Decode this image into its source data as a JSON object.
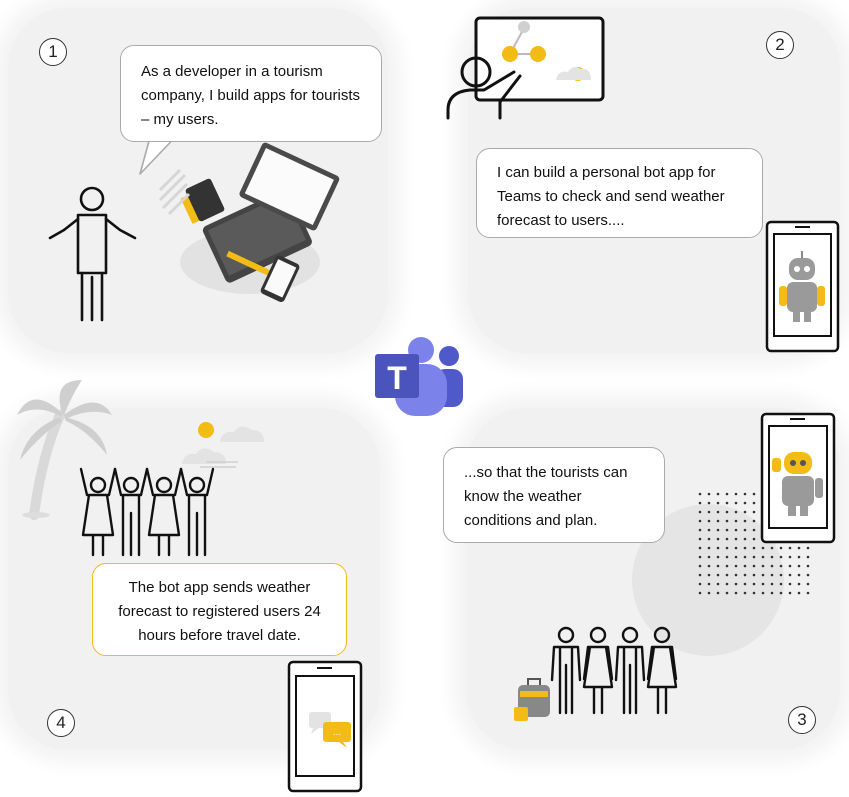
{
  "steps": [
    {
      "number": "1",
      "text": "As a developer in a tourism company, I build apps for tourists – my users."
    },
    {
      "number": "2",
      "text": "I can build a personal bot app for Teams to check and send weather forecast to users...."
    },
    {
      "number": "3",
      "text": "...so that the tourists can know the weather conditions and plan."
    },
    {
      "number": "4",
      "text": "The bot app sends weather forecast to registered users 24 hours before travel date."
    }
  ],
  "center_logo": {
    "letter": "T",
    "icon": "teams-logo-icon"
  },
  "phone_bubble_text": "...",
  "colors": {
    "accent_yellow": "#f2bb16",
    "teams_purple": "#5059c9",
    "teams_purple_light": "#7b83eb",
    "panel_bg": "#f1f1f1",
    "outline": "#111111"
  }
}
